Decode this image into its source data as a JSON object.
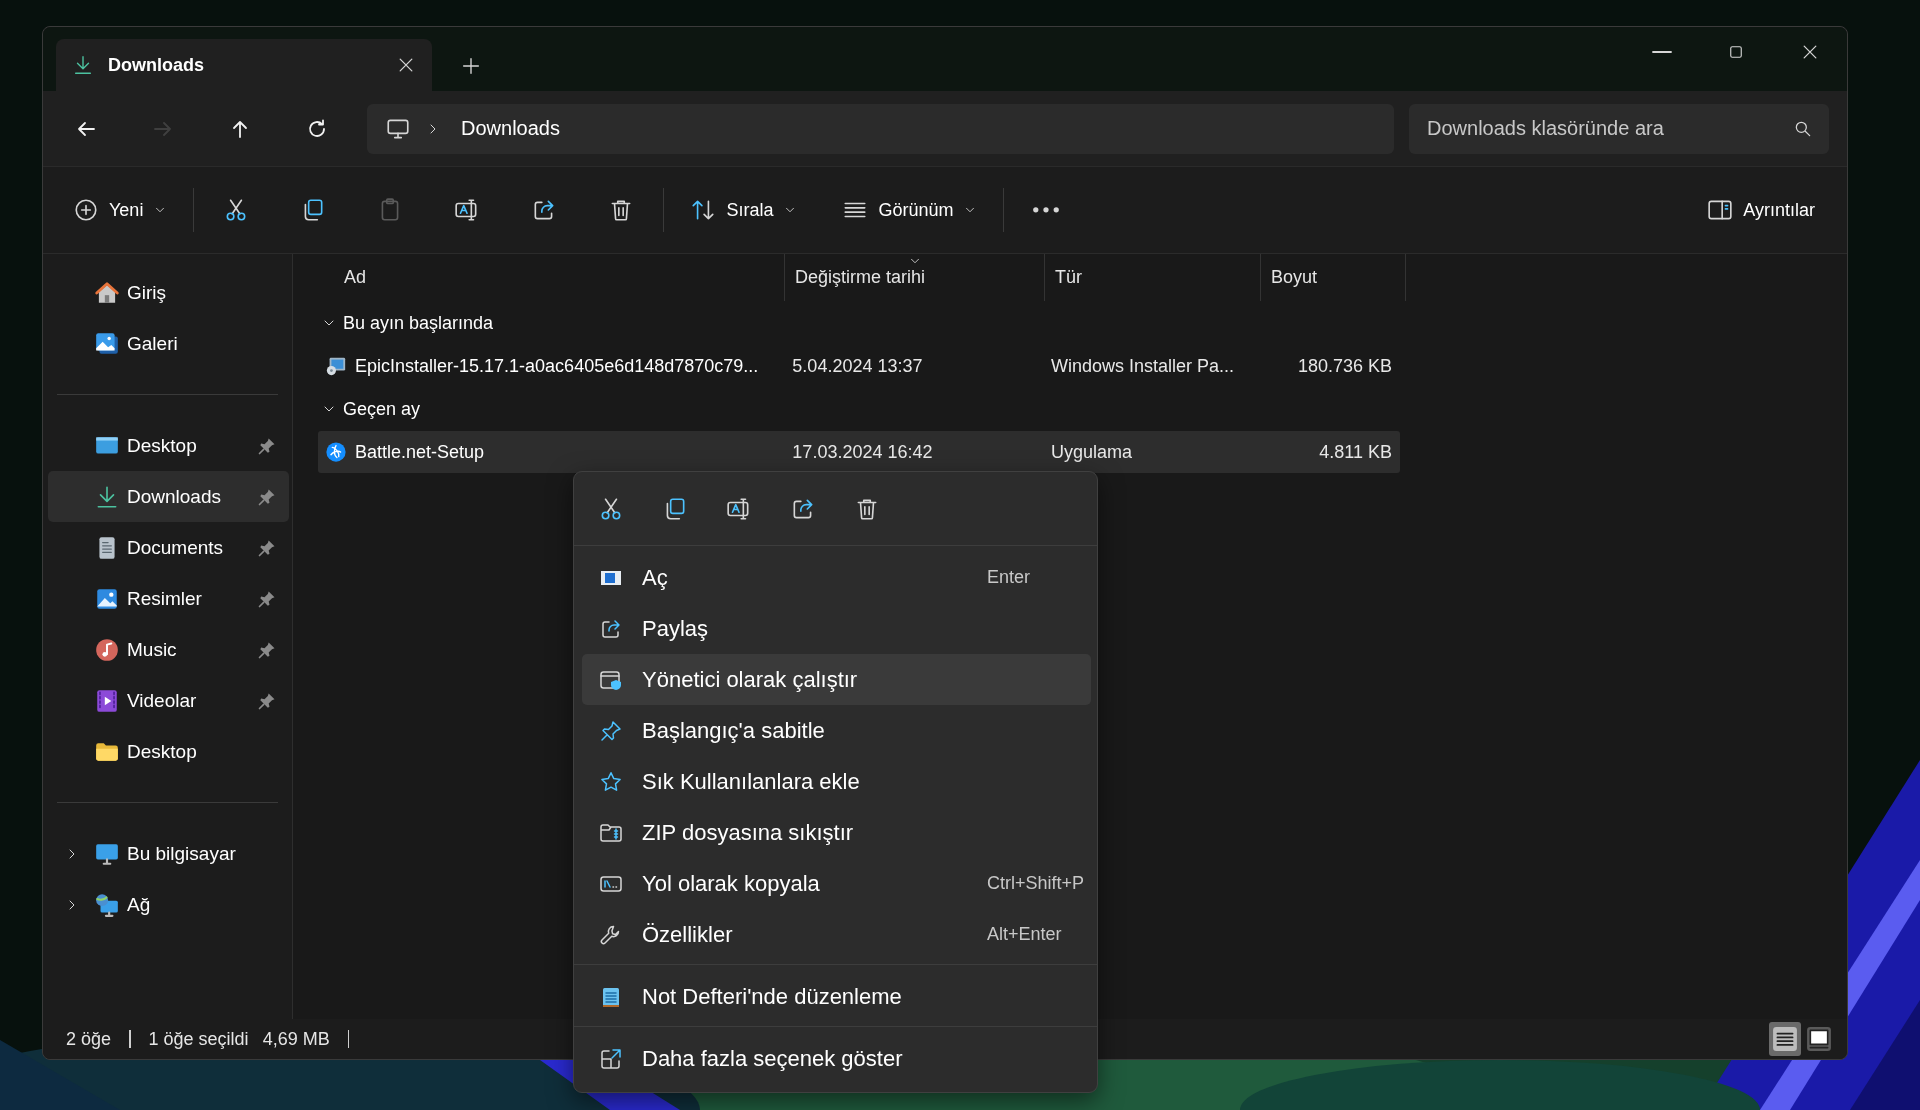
{
  "tab": {
    "title": "Downloads"
  },
  "nav": [
    {
      "kind": "back",
      "disabled": false
    },
    {
      "kind": "forward",
      "disabled": true
    },
    {
      "kind": "up",
      "disabled": false
    },
    {
      "kind": "refresh",
      "disabled": false
    }
  ],
  "address": {
    "crumbs": [
      "Downloads"
    ]
  },
  "search": {
    "placeholder": "Downloads klasöründe ara"
  },
  "toolbar": {
    "groups": [
      [
        {
          "kind": "new",
          "label": "Yeni",
          "disabled": false
        }
      ],
      [
        {
          "kind": "cut",
          "disabled": false
        },
        {
          "kind": "copy",
          "disabled": false
        },
        {
          "kind": "paste",
          "disabled": true
        },
        {
          "kind": "rename",
          "disabled": false
        },
        {
          "kind": "share",
          "disabled": false
        },
        {
          "kind": "delete",
          "disabled": false
        }
      ],
      [
        {
          "kind": "sort",
          "label": "Sırala",
          "disabled": false
        },
        {
          "kind": "view",
          "label": "Görünüm",
          "disabled": false
        }
      ],
      [
        {
          "kind": "more",
          "disabled": false
        }
      ]
    ],
    "details": {
      "label": "Ayrıntılar"
    }
  },
  "sidebar": {
    "sections": [
      [
        {
          "kind": "home",
          "label": "Giriş",
          "selected": false,
          "pinned": false
        },
        {
          "kind": "gallery",
          "label": "Galeri",
          "selected": false,
          "pinned": false
        }
      ],
      [
        {
          "kind": "desktop",
          "label": "Desktop",
          "selected": false,
          "pinned": true
        },
        {
          "kind": "downloads",
          "label": "Downloads",
          "selected": true,
          "pinned": true
        },
        {
          "kind": "documents",
          "label": "Documents",
          "selected": false,
          "pinned": true
        },
        {
          "kind": "pictures",
          "label": "Resimler",
          "selected": false,
          "pinned": true
        },
        {
          "kind": "music",
          "label": "Music",
          "selected": false,
          "pinned": true
        },
        {
          "kind": "videos",
          "label": "Videolar",
          "selected": false,
          "pinned": true
        },
        {
          "kind": "folder",
          "label": "Desktop",
          "selected": false,
          "pinned": false
        }
      ],
      [
        {
          "kind": "computer",
          "label": "Bu bilgisayar",
          "selected": false,
          "pinned": false,
          "expanded": false
        },
        {
          "kind": "network",
          "label": "Ağ",
          "selected": false,
          "pinned": false,
          "expanded": false
        }
      ]
    ]
  },
  "columns": [
    {
      "label": "Ad",
      "sorted": false
    },
    {
      "label": "Değiştirme tarihi",
      "sorted": true
    },
    {
      "label": "Tür",
      "sorted": false
    },
    {
      "label": "Boyut",
      "sorted": false
    }
  ],
  "groups": [
    {
      "title": "Bu ayın başlarında",
      "expanded": true,
      "rows": [
        {
          "kind": "installer",
          "name": "EpicInstaller-15.17.1-a0ac6405e6d148d7870c79...",
          "date": "5.04.2024 13:37",
          "type": "Windows Installer Pa...",
          "size": "180.736 KB",
          "selected": false
        }
      ]
    },
    {
      "title": "Geçen ay",
      "expanded": true,
      "rows": [
        {
          "kind": "app",
          "name": "Battle.net-Setup",
          "date": "17.03.2024 16:42",
          "type": "Uygulama",
          "size": "4.811 KB",
          "selected": true
        }
      ]
    }
  ],
  "context_menu": {
    "actions": [
      {
        "kind": "cut"
      },
      {
        "kind": "copy"
      },
      {
        "kind": "rename"
      },
      {
        "kind": "share"
      },
      {
        "kind": "delete"
      }
    ],
    "sections": [
      [
        {
          "kind": "open",
          "label": "Aç",
          "shortcut": "Enter",
          "selected": false
        },
        {
          "kind": "share",
          "label": "Paylaş",
          "selected": false
        },
        {
          "kind": "admin",
          "label": "Yönetici olarak çalıştır",
          "selected": true
        },
        {
          "kind": "pinout",
          "label": "Başlangıç'a sabitle",
          "selected": false
        },
        {
          "kind": "star",
          "label": "Sık Kullanılanlara ekle",
          "selected": false
        },
        {
          "kind": "zip",
          "label": "ZIP dosyasına sıkıştır",
          "selected": false
        },
        {
          "kind": "path",
          "label": "Yol olarak kopyala",
          "shortcut": "Ctrl+Shift+P",
          "selected": false
        },
        {
          "kind": "wrench",
          "label": "Özellikler",
          "shortcut": "Alt+Enter",
          "selected": false
        }
      ],
      [
        {
          "kind": "notepad",
          "label": "Not Defteri'nde düzenleme",
          "selected": false
        }
      ],
      [
        {
          "kind": "moreopt",
          "label": "Daha fazla seçenek göster",
          "selected": false
        }
      ]
    ]
  },
  "status_bar": {
    "count": "2 öğe",
    "selection": "1 öğe seçildi",
    "size": "4,69 MB"
  },
  "view_modes": [
    {
      "kind": "details",
      "selected": true
    },
    {
      "kind": "tiles",
      "selected": false
    }
  ]
}
